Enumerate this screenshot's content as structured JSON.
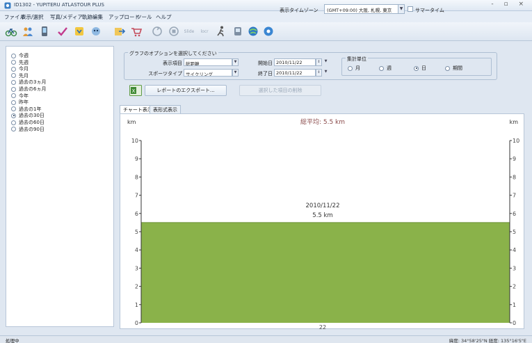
{
  "window": {
    "title": "ID1302 - YUPITERU ATLASTOUR PLUS",
    "controls": "- ▫ ×"
  },
  "menu": [
    "ファイル",
    "表示/選択",
    "写真/メディア",
    "軌跡編集",
    "アップロード",
    "ツール",
    "ヘルプ"
  ],
  "toolbar": {
    "icons": [
      "bike-icon",
      "people-icon",
      "phone-icon",
      "checkmark-icon",
      "bookmark-icon",
      "robot-icon",
      "export-icon",
      "cart-icon",
      "recycle-icon",
      "sync-icon",
      "slide-icon",
      "locr-icon",
      "runner-icon",
      "gps-icon",
      "globe-icon",
      "globe-settings-icon"
    ],
    "text_icons": {
      "slide": "Slide",
      "locr": "locr"
    },
    "timezone_label": "表示タイムゾーン",
    "timezone_value": "(GMT+09:00) 大阪, 札幌, 東京",
    "summer_time_label": "サマータイム"
  },
  "period": {
    "options": [
      "今週",
      "先週",
      "今月",
      "先月",
      "過去の3ヵ月",
      "過去の6ヵ月",
      "今年",
      "昨年",
      "過去の1年",
      "過去の30日",
      "過去の60日",
      "過去の90日"
    ],
    "selected_index": 9
  },
  "graph_options": {
    "legend": "グラフのオプションを選択してください",
    "display_label": "表示項目",
    "display_value": "総距離",
    "sport_label": "スポーツタイプ",
    "sport_value": "サイクリング",
    "start_label": "開始日",
    "start_value": "2010/11/22",
    "end_label": "終了日",
    "end_value": "2010/11/22",
    "aggregate_legend": "集計単位",
    "aggregate_options": [
      "月",
      "週",
      "日",
      "期間"
    ],
    "aggregate_selected_index": 2
  },
  "actions": {
    "export_label": "レポートのエクスポート...",
    "delete_label": "選択した項目の削除",
    "excel_glyph": "X"
  },
  "tabs": [
    "チャート表示",
    "表形式表示"
  ],
  "active_tab_index": 0,
  "chart_data": {
    "type": "bar",
    "title": "総平均: 5.5 km",
    "ylabel_left": "km",
    "ylabel_right": "km",
    "categories": [
      "22"
    ],
    "values": [
      5.5
    ],
    "ylim": [
      0,
      10
    ],
    "yticks": [
      0,
      1,
      2,
      3,
      4,
      5,
      6,
      7,
      8,
      9,
      10
    ],
    "bar_label_date": "2010/11/22",
    "bar_label_value": "5.5 km",
    "bar_color": "#8ab24a",
    "grid": false
  },
  "status": {
    "left": "処理中",
    "right": "緯度: 34°58'25\"N 経度: 135°16'5\"E"
  }
}
